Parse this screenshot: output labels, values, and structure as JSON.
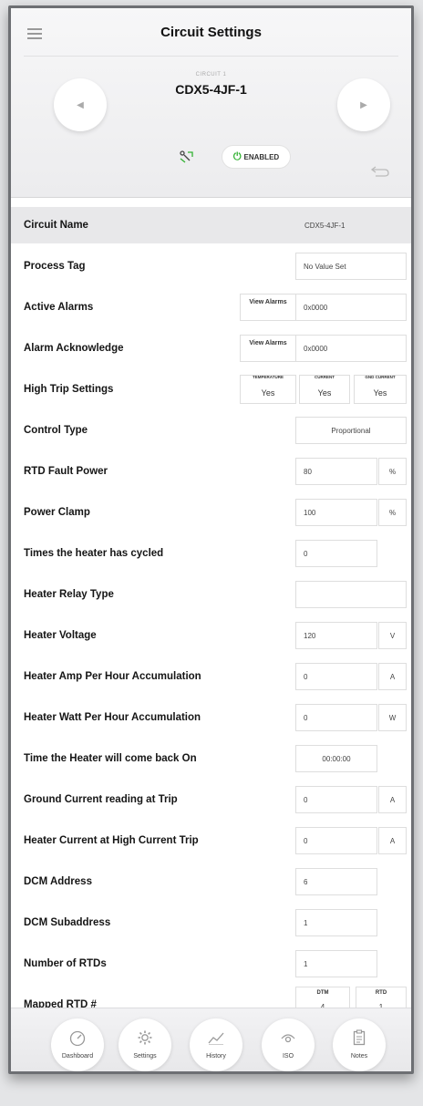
{
  "header": {
    "title": "Circuit Settings",
    "circuit_caption": "CIRCUIT 1",
    "circuit_id": "CDX5-4JF-1",
    "prev_glyph": "◀",
    "next_glyph": "▶",
    "status_label": "ENABLED",
    "status_icon": "⏻",
    "colors": {
      "enabled": "#32b232",
      "active_tab": "#e21b26"
    }
  },
  "rows": {
    "circuit_name": {
      "label": "Circuit Name",
      "value": "CDX5-4JF-1"
    },
    "process_tag": {
      "label": "Process Tag",
      "value": "No Value Set"
    },
    "active_alarms": {
      "label": "Active Alarms",
      "button": "View Alarms",
      "value": "0x0000"
    },
    "alarm_ack": {
      "label": "Alarm Acknowledge",
      "button": "View Alarms",
      "value": "0x0000"
    },
    "high_trip": {
      "label": "High Trip Settings",
      "temperature_caption": "TEMPERATURE",
      "temperature_value": "Yes",
      "current_caption": "CURRENT",
      "current_value": "Yes",
      "gnd_caption": "GND CURRENT",
      "gnd_value": "Yes"
    },
    "control_type": {
      "label": "Control Type",
      "value": "Proportional"
    },
    "rtd_fault_power": {
      "label": "RTD Fault Power",
      "value": "80",
      "unit": "%"
    },
    "power_clamp": {
      "label": "Power Clamp",
      "value": "100",
      "unit": "%"
    },
    "times_cycled": {
      "label": "Times the heater has cycled",
      "value": "0"
    },
    "relay_type": {
      "label": "Heater Relay Type",
      "value": ""
    },
    "heater_voltage": {
      "label": "Heater Voltage",
      "value": "120",
      "unit": "V"
    },
    "amp_hour": {
      "label": "Heater Amp Per Hour Accumulation",
      "value": "0",
      "unit": "A"
    },
    "watt_hour": {
      "label": "Heater Watt Per Hour Accumulation",
      "value": "0",
      "unit": "W"
    },
    "back_on": {
      "label": "Time the Heater will come back On",
      "value": "00:00:00"
    },
    "ground_trip": {
      "label": "Ground Current reading at Trip",
      "value": "0",
      "unit": "A"
    },
    "high_current_trip": {
      "label": "Heater Current at High Current Trip",
      "value": "0",
      "unit": "A"
    },
    "dcm_address": {
      "label": "DCM Address",
      "value": "6"
    },
    "dcm_subaddress": {
      "label": "DCM Subaddress",
      "value": "1"
    },
    "num_rtds": {
      "label": "Number of RTDs",
      "value": "1"
    },
    "mapped_rtd": {
      "label": "Mapped RTD #",
      "dtm_caption": "DTM",
      "dtm_value": "4",
      "rtd_caption": "RTD",
      "rtd_value": "1"
    }
  },
  "bottom_nav": {
    "dashboard": "Dashboard",
    "settings": "Settings",
    "history": "History",
    "iso": "ISO",
    "notes": "Notes"
  }
}
